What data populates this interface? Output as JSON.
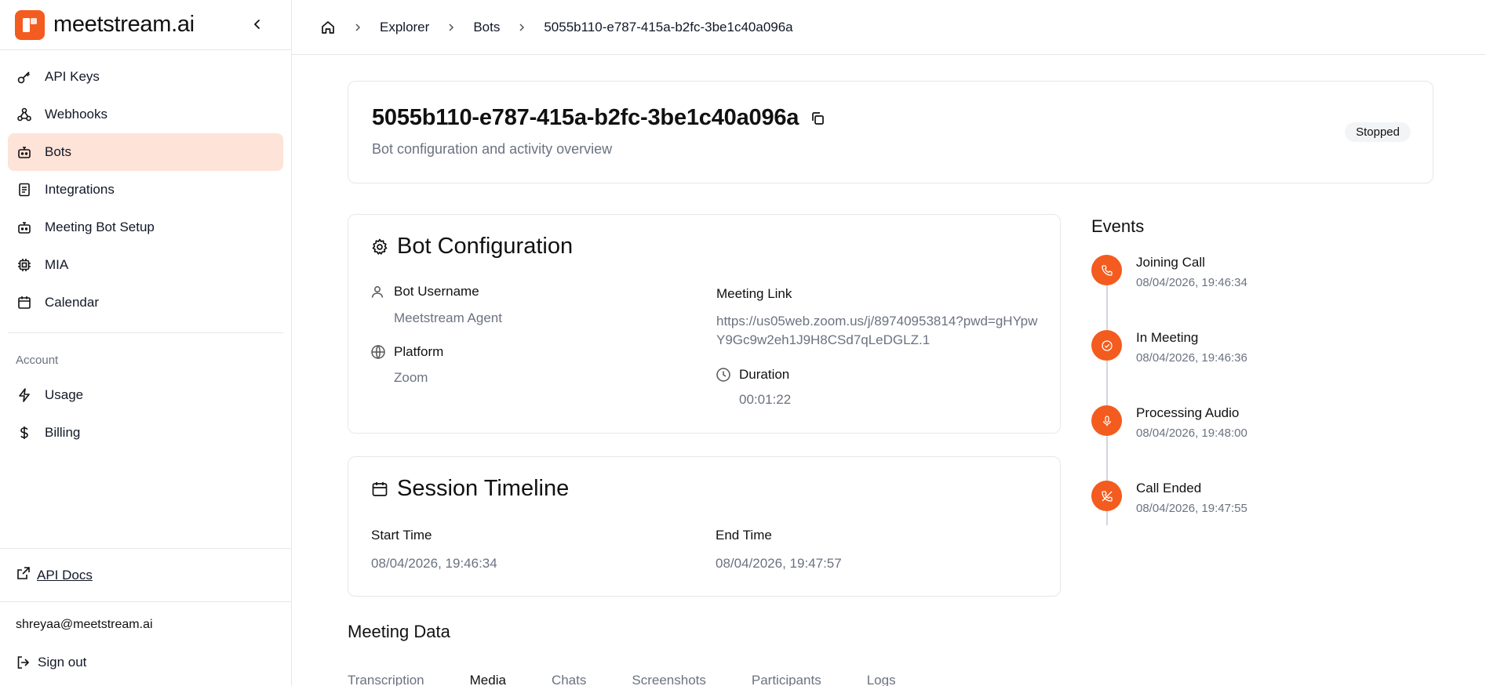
{
  "brand": {
    "name": "meetstream.ai"
  },
  "sidebar": {
    "items": [
      {
        "label": "API Keys",
        "icon": "key-icon"
      },
      {
        "label": "Webhooks",
        "icon": "webhook-icon"
      },
      {
        "label": "Bots",
        "icon": "bot-icon",
        "active": true
      },
      {
        "label": "Integrations",
        "icon": "document-icon"
      },
      {
        "label": "Meeting Bot Setup",
        "icon": "bot-icon"
      },
      {
        "label": "MIA",
        "icon": "chip-icon"
      },
      {
        "label": "Calendar",
        "icon": "calendar-icon"
      }
    ],
    "account_label": "Account",
    "account_items": [
      {
        "label": "Usage",
        "icon": "bolt-icon"
      },
      {
        "label": "Billing",
        "icon": "dollar-icon"
      }
    ],
    "api_docs": "API Docs",
    "user_email": "shreyaa@meetstream.ai",
    "sign_out": "Sign out"
  },
  "breadcrumb": {
    "items": [
      "Explorer",
      "Bots",
      "5055b110-e787-415a-b2fc-3be1c40a096a"
    ]
  },
  "header": {
    "bot_id": "5055b110-e787-415a-b2fc-3be1c40a096a",
    "subtitle": "Bot configuration and activity overview",
    "status": "Stopped"
  },
  "config": {
    "title": "Bot Configuration",
    "bot_username_label": "Bot Username",
    "bot_username": "Meetstream Agent",
    "platform_label": "Platform",
    "platform": "Zoom",
    "meeting_link_label": "Meeting Link",
    "meeting_link": "https://us05web.zoom.us/j/89740953814?pwd=gHYpwY9Gc9w2eh1J9H8CSd7qLeDGLZ.1",
    "duration_label": "Duration",
    "duration": "00:01:22"
  },
  "session": {
    "title": "Session Timeline",
    "start_label": "Start Time",
    "start": "08/04/2026, 19:46:34",
    "end_label": "End Time",
    "end": "08/04/2026, 19:47:57"
  },
  "events": {
    "title": "Events",
    "items": [
      {
        "name": "Joining Call",
        "time": "08/04/2026, 19:46:34",
        "icon": "phone-icon"
      },
      {
        "name": "In Meeting",
        "time": "08/04/2026, 19:46:36",
        "icon": "check-circle-icon"
      },
      {
        "name": "Processing Audio",
        "time": "08/04/2026, 19:48:00",
        "icon": "mic-icon"
      },
      {
        "name": "Call Ended",
        "time": "08/04/2026, 19:47:55",
        "icon": "phone-off-icon"
      }
    ]
  },
  "meeting_data": {
    "title": "Meeting Data",
    "tabs": [
      "Transcription",
      "Media",
      "Chats",
      "Screenshots",
      "Participants",
      "Logs"
    ],
    "active_tab": "Media"
  },
  "colors": {
    "accent": "#f45b1e",
    "active_bg": "#fde3d8"
  }
}
